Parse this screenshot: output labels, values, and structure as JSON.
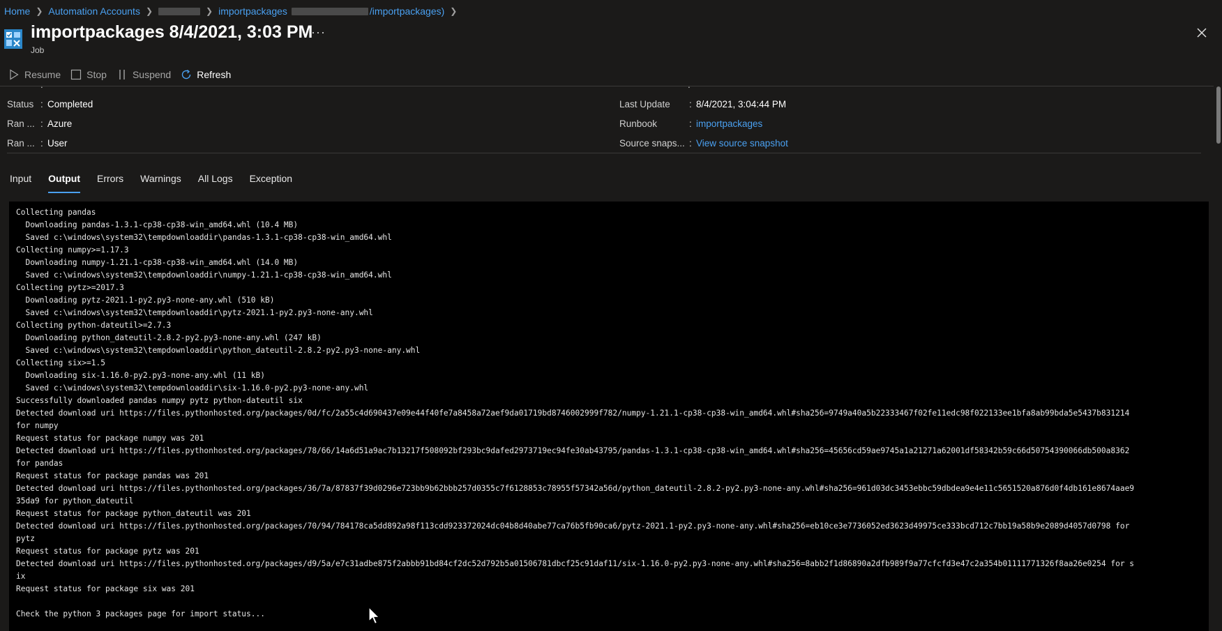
{
  "breadcrumb": {
    "home": "Home",
    "automation_accounts": "Automation Accounts",
    "runbook_link": "importpackages",
    "runbook_link_suffix": "/importpackages)"
  },
  "header": {
    "title": "importpackages 8/4/2021, 3:03 PM",
    "subtitle": "Job",
    "more_icon": "ellipsis-icon",
    "close_icon": "close-icon"
  },
  "toolbar": {
    "resume": "Resume",
    "stop": "Stop",
    "suspend": "Suspend",
    "refresh": "Refresh"
  },
  "properties": {
    "status_label": "Status",
    "status_value": "Completed",
    "ran_on_label": "Ran ...",
    "ran_on_value": "Azure",
    "ran_by_label": "Ran ...",
    "ran_by_value": "User",
    "last_update_label": "Last Update",
    "last_update_value": "8/4/2021, 3:04:44 PM",
    "runbook_label": "Runbook",
    "runbook_value": "importpackages",
    "source_label": "Source snaps...",
    "source_value": "View source snapshot",
    "separator": ":"
  },
  "tabs": [
    "Input",
    "Output",
    "Errors",
    "Warnings",
    "All Logs",
    "Exception"
  ],
  "active_tab": "Output",
  "output": "Collecting pandas\n  Downloading pandas-1.3.1-cp38-cp38-win_amd64.whl (10.4 MB)\n  Saved c:\\windows\\system32\\tempdownloaddir\\pandas-1.3.1-cp38-cp38-win_amd64.whl\nCollecting numpy>=1.17.3\n  Downloading numpy-1.21.1-cp38-cp38-win_amd64.whl (14.0 MB)\n  Saved c:\\windows\\system32\\tempdownloaddir\\numpy-1.21.1-cp38-cp38-win_amd64.whl\nCollecting pytz>=2017.3\n  Downloading pytz-2021.1-py2.py3-none-any.whl (510 kB)\n  Saved c:\\windows\\system32\\tempdownloaddir\\pytz-2021.1-py2.py3-none-any.whl\nCollecting python-dateutil>=2.7.3\n  Downloading python_dateutil-2.8.2-py2.py3-none-any.whl (247 kB)\n  Saved c:\\windows\\system32\\tempdownloaddir\\python_dateutil-2.8.2-py2.py3-none-any.whl\nCollecting six>=1.5\n  Downloading six-1.16.0-py2.py3-none-any.whl (11 kB)\n  Saved c:\\windows\\system32\\tempdownloaddir\\six-1.16.0-py2.py3-none-any.whl\nSuccessfully downloaded pandas numpy pytz python-dateutil six\nDetected download uri https://files.pythonhosted.org/packages/0d/fc/2a55c4d690437e09e44f40fe7a8458a72aef9da01719bd8746002999f782/numpy-1.21.1-cp38-cp38-win_amd64.whl#sha256=9749a40a5b22333467f02fe11edc98f022133ee1bfa8ab99bda5e5437b831214\nfor numpy\nRequest status for package numpy was 201\nDetected download uri https://files.pythonhosted.org/packages/78/66/14a6d51a9ac7b13217f508092bf293bc9dafed2973719ec94fe30ab43795/pandas-1.3.1-cp38-cp38-win_amd64.whl#sha256=45656cd59ae9745a1a21271a62001df58342b59c66d50754390066db500a8362\nfor pandas\nRequest status for package pandas was 201\nDetected download uri https://files.pythonhosted.org/packages/36/7a/87837f39d0296e723bb9b62bbb257d0355c7f6128853c78955f57342a56d/python_dateutil-2.8.2-py2.py3-none-any.whl#sha256=961d03dc3453ebbc59dbdea9e4e11c5651520a876d0f4db161e8674aae9\n35da9 for python_dateutil\nRequest status for package python_dateutil was 201\nDetected download uri https://files.pythonhosted.org/packages/70/94/784178ca5dd892a98f113cdd923372024dc04b8d40abe77ca76b5fb90ca6/pytz-2021.1-py2.py3-none-any.whl#sha256=eb10ce3e7736052ed3623d49975ce333bcd712c7bb19a58b9e2089d4057d0798 for\npytz\nRequest status for package pytz was 201\nDetected download uri https://files.pythonhosted.org/packages/d9/5a/e7c31adbe875f2abbb91bd84cf2dc52d792b5a01506781dbcf25c91daf11/six-1.16.0-py2.py3-none-any.whl#sha256=8abb2f1d86890a2dfb989f9a77cfcfd3e47c2a354b01111771326f8aa26e0254 for s\nix\nRequest status for package six was 201\n\nCheck the python 3 packages page for import status...",
  "colors": {
    "background": "#1b1a19",
    "link": "#4aa0f0",
    "output_background": "#000000"
  }
}
